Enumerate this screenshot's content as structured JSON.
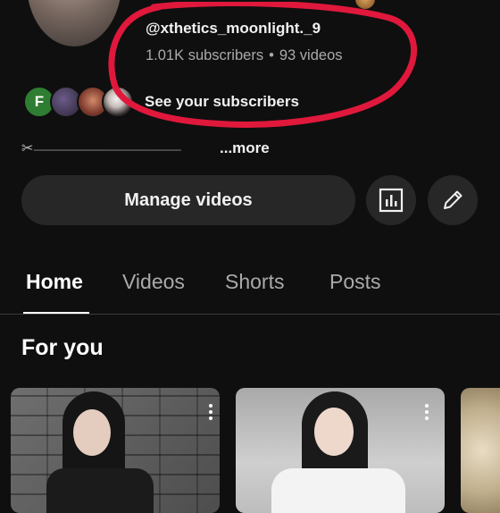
{
  "channel": {
    "name_partial": "",
    "handle": "@xthetics_moonlight._9",
    "subscribers": "1.01K subscribers",
    "separator": "•",
    "videos": "93 videos",
    "subscriber_avatar_letter": "F",
    "see_subscribers": "See your subscribers",
    "description_icon": "✂",
    "description_dashes": "-------------------------------------------------------",
    "more": "...more"
  },
  "actions": {
    "manage_videos": "Manage videos",
    "analytics_icon": "analytics-icon",
    "edit_icon": "pencil-icon"
  },
  "tabs": [
    {
      "label": "Home",
      "active": true
    },
    {
      "label": "Videos",
      "active": false
    },
    {
      "label": "Shorts",
      "active": false
    },
    {
      "label": "Posts",
      "active": false
    }
  ],
  "section": {
    "title": "For you"
  },
  "colors": {
    "background": "#0f0f0f",
    "button_bg": "#272727",
    "annotation_red": "#e0183c",
    "avatar_green": "#2e7d32"
  }
}
